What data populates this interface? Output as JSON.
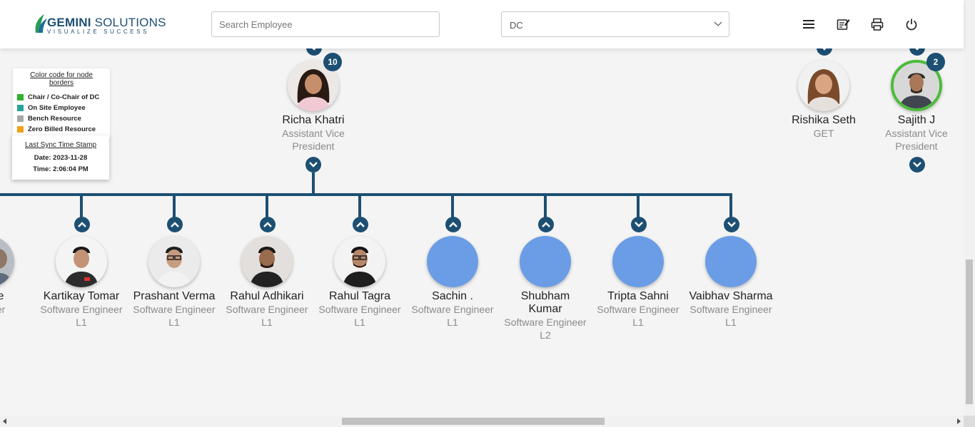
{
  "header": {
    "logo_name_bold": "GEMINI",
    "logo_name_rest": " SOLUTIONS",
    "logo_tagline": "VISUALIZE SUCCESS",
    "search_placeholder": "Search Employee",
    "department_select_value": "DC",
    "icons": [
      "menu-icon",
      "notes-icon",
      "print-icon",
      "power-icon"
    ]
  },
  "legend": {
    "title": "Color code for node borders",
    "items": [
      {
        "label": "Chair / Co-Chair of DC",
        "color": "#2fb22f"
      },
      {
        "label": "On Site Employee",
        "color": "#2aa19b"
      },
      {
        "label": "Bench Resource",
        "color": "#a6a6a6"
      },
      {
        "label": "Zero Billed Resource",
        "color": "#f2a11a"
      }
    ]
  },
  "sync": {
    "title": "Last Sync Time Stamp",
    "date": "Date: 2023-11-28",
    "time": "Time: 2:06:04 PM"
  },
  "top_nodes": [
    {
      "name": "Richa Khatri",
      "role_line1": "Assistant Vice",
      "role_line2": "President",
      "badge": "10"
    },
    {
      "name": "Rishika Seth",
      "role_line1": "GET",
      "role_line2": ""
    },
    {
      "name": "Sajith J",
      "role_line1": "Assistant Vice",
      "role_line2": "President",
      "badge": "2"
    }
  ],
  "children": [
    {
      "name": "Khare",
      "role_line1": "ngineer",
      "role_line2": ""
    },
    {
      "name": "Kartikay Tomar",
      "role_line1": "Software Engineer",
      "role_line2": "L1"
    },
    {
      "name": "Prashant Verma",
      "role_line1": "Software Engineer",
      "role_line2": "L1"
    },
    {
      "name": "Rahul Adhikari",
      "role_line1": "Software Engineer",
      "role_line2": "L1"
    },
    {
      "name": "Rahul Tagra",
      "role_line1": "Software Engineer",
      "role_line2": "L1"
    },
    {
      "name": "Sachin .",
      "role_line1": "Software Engineer",
      "role_line2": "L1"
    },
    {
      "name": "Shubham",
      "name_line2": "Kumar",
      "role_line1": "Software Engineer",
      "role_line2": "L2"
    },
    {
      "name": "Tripta Sahni",
      "role_line1": "Software Engineer",
      "role_line2": "L1"
    },
    {
      "name": "Vaibhav Sharma",
      "role_line1": "Software Engineer",
      "role_line2": "L1"
    }
  ],
  "colors": {
    "primary": "#1d4f73",
    "placeholder_avatar": "#6b9de6",
    "chair_border": "#4bbb3a"
  }
}
